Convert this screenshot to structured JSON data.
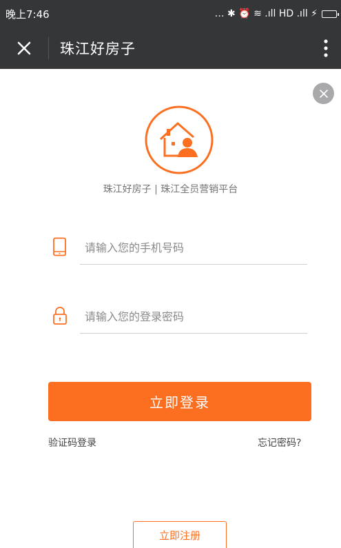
{
  "status_bar": {
    "time": "晚上7:46",
    "indicators": "… ✱ ⏰ ≋ .ıll HD .ıll ⚡"
  },
  "title_bar": {
    "close_icon": "close-icon",
    "title": "珠江好房子",
    "menu_icon": "more-vertical-icon"
  },
  "dismiss": {
    "icon": "close-circle-icon"
  },
  "brand": {
    "logo_icon": "house-agent-logo-icon",
    "tagline": "珠江好房子 | 珠江全员营销平台"
  },
  "form": {
    "phone": {
      "icon": "mobile-phone-icon",
      "placeholder": "请输入您的手机号码",
      "value": ""
    },
    "password": {
      "icon": "lock-icon",
      "placeholder": "请输入您的登录密码",
      "value": ""
    }
  },
  "actions": {
    "login_label": "立即登录",
    "sms_login_label": "验证码登录",
    "forgot_label": "忘记密码?",
    "register_label": "立即注册"
  },
  "colors": {
    "accent": "#fc6f21",
    "bar_background": "#353638",
    "dismiss_gray": "#a9a9ab"
  }
}
